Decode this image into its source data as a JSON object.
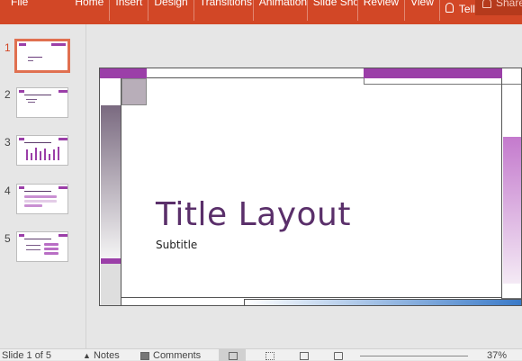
{
  "ribbon": {
    "file": "File",
    "tabs": [
      "Home",
      "Insert",
      "Design",
      "Transitions",
      "Animations",
      "Slide Show",
      "Review",
      "View"
    ],
    "tell_me": "Tell me",
    "share": "Share"
  },
  "thumbnails": [
    {
      "number": "1",
      "active": true
    },
    {
      "number": "2",
      "active": false
    },
    {
      "number": "3",
      "active": false
    },
    {
      "number": "4",
      "active": false
    },
    {
      "number": "5",
      "active": false
    }
  ],
  "slide": {
    "title": "Title Layout",
    "subtitle": "Subtitle"
  },
  "status": {
    "slide_info": "Slide 1 of 5",
    "notes": "Notes",
    "comments": "Comments",
    "zoom": "37%"
  },
  "colors": {
    "ribbon": "#d24726",
    "accent_purple": "#9b3fa8",
    "title_text": "#5a2f6a"
  }
}
